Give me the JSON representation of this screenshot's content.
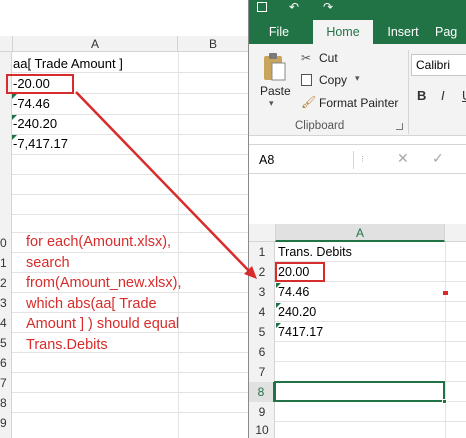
{
  "left_sheet": {
    "columns": [
      "A",
      "B"
    ],
    "cells": [
      "aa[ Trade Amount ]",
      "-20.00",
      "-74.46",
      "-240.20",
      "-7,417.17"
    ],
    "row_numbers": [
      "0",
      "1",
      "2",
      "3",
      "4",
      "5",
      "6",
      "7",
      "8",
      "9"
    ],
    "annotation": [
      "for each(Amount.xlsx),",
      "search",
      "from(Amount_new.xlsx),",
      "which abs(aa[ Trade",
      "Amount ] ) should equal",
      "Trans.Debits"
    ]
  },
  "excel": {
    "ribbon_tabs": [
      "File",
      "Home",
      "Insert",
      "Pag"
    ],
    "active_tab": "Home",
    "clipboard": {
      "paste": "Paste",
      "cut": "Cut",
      "copy": "Copy",
      "format_painter": "Format Painter",
      "group_label": "Clipboard"
    },
    "font": {
      "name": "Calibri",
      "bold": "B",
      "italic": "I",
      "underline": "U"
    },
    "name_box": "A8",
    "formula_cancel": "✕",
    "formula_enter": "✓",
    "sheet": {
      "column": "A",
      "rows": [
        {
          "num": "1",
          "value": "Trans. Debits"
        },
        {
          "num": "2",
          "value": "20.00"
        },
        {
          "num": "3",
          "value": "74.46"
        },
        {
          "num": "4",
          "value": "240.20"
        },
        {
          "num": "5",
          "value": "7417.17"
        },
        {
          "num": "6",
          "value": ""
        },
        {
          "num": "7",
          "value": ""
        },
        {
          "num": "8",
          "value": ""
        },
        {
          "num": "9",
          "value": ""
        },
        {
          "num": "10",
          "value": ""
        }
      ],
      "active_cell": "A8"
    }
  },
  "colors": {
    "excel_green": "#217346",
    "annotation_red": "#d82b2b",
    "number_flag": "#1e7145"
  }
}
